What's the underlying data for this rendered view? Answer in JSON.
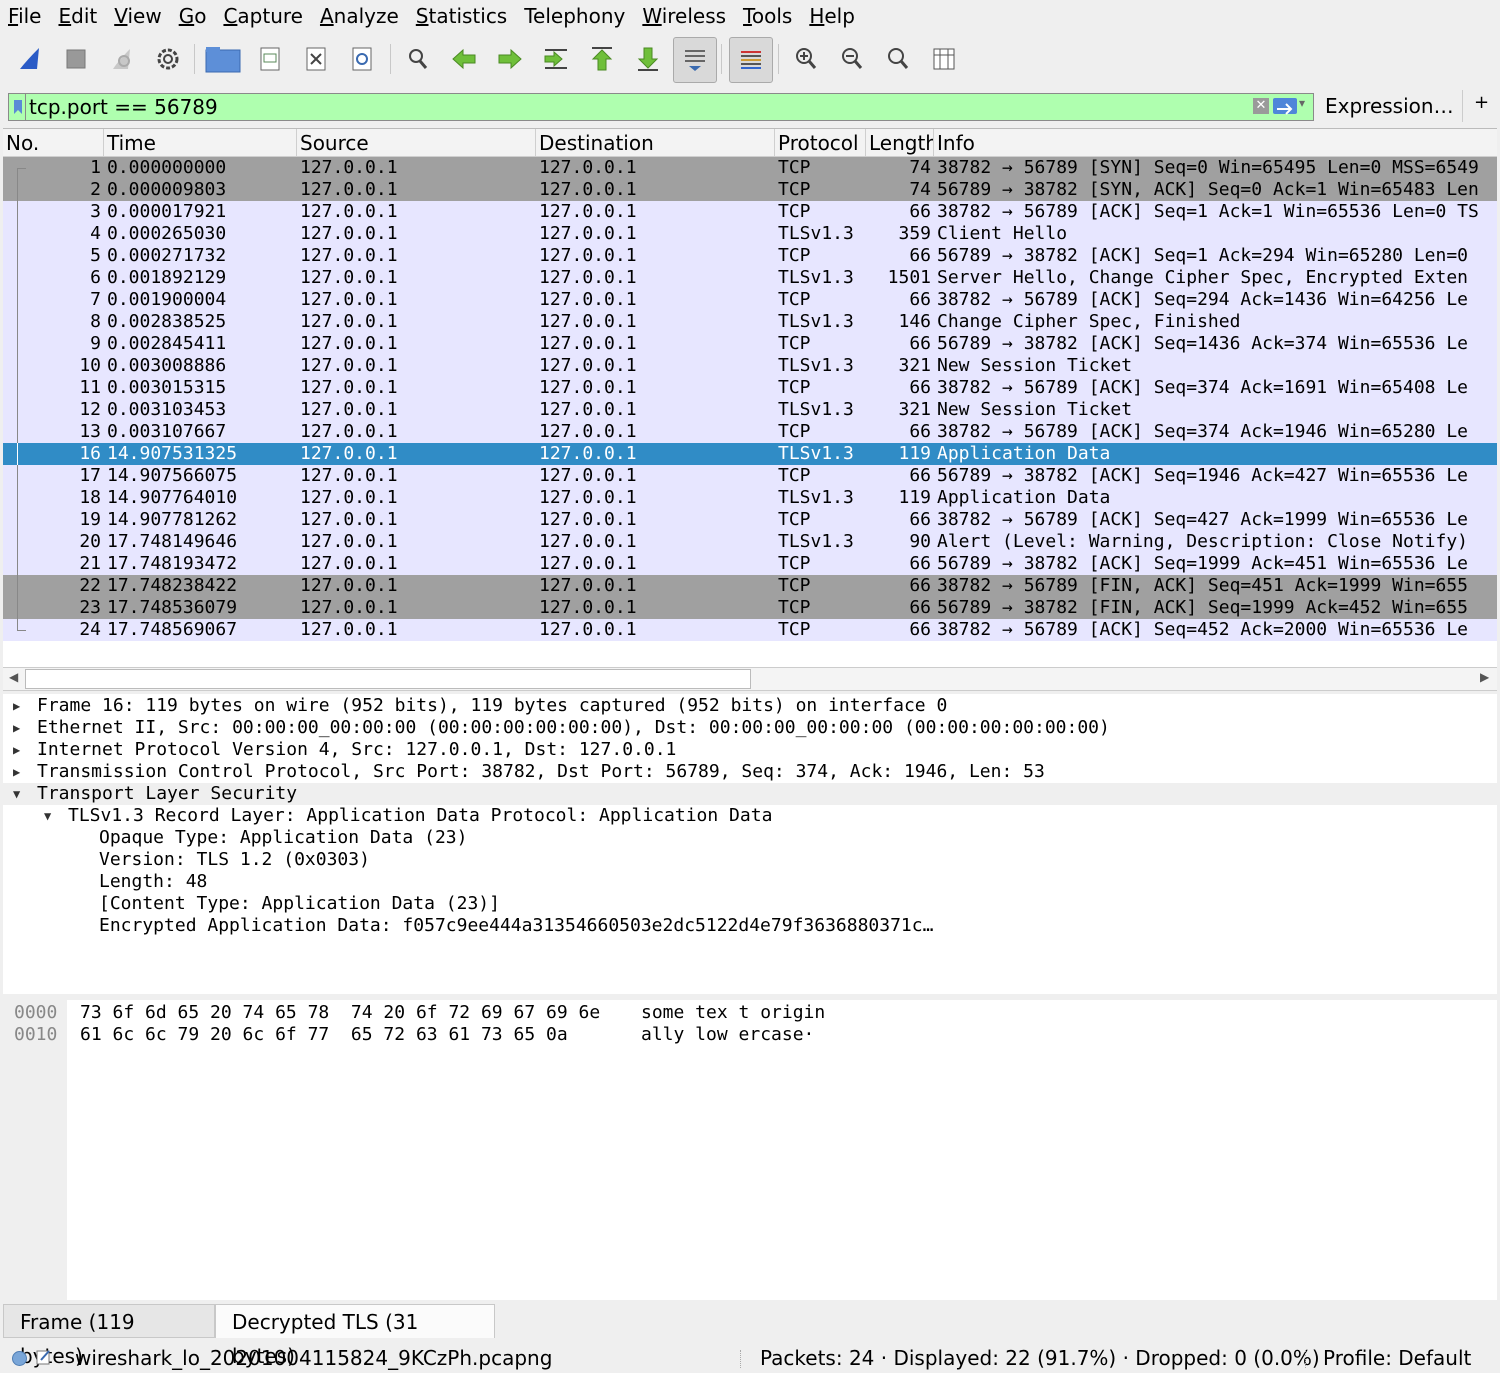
{
  "menu": [
    "File",
    "Edit",
    "View",
    "Go",
    "Capture",
    "Analyze",
    "Statistics",
    "Telephony",
    "Wireless",
    "Tools",
    "Help"
  ],
  "menu_mnemonic": [
    "F",
    "E",
    "V",
    "G",
    "C",
    "A",
    "S",
    "",
    "W",
    "T",
    "H"
  ],
  "toolbar_icons": [
    "shark-fin-start-icon",
    "stop-icon",
    "restart-icon",
    "options-gear-icon",
    "open-folder-icon",
    "save-icon",
    "close-file-icon",
    "reload-icon",
    "find-icon",
    "go-back-icon",
    "go-forward-icon",
    "go-to-packet-icon",
    "first-packet-icon",
    "last-packet-icon",
    "autoscroll-icon",
    "colorize-icon",
    "zoom-in-icon",
    "zoom-out-icon",
    "normal-size-icon",
    "resize-columns-icon"
  ],
  "filter": {
    "value": "tcp.port == 56789",
    "expression_label": "Expression…",
    "plus_label": "+"
  },
  "columns": [
    "No.",
    "Time",
    "Source",
    "Destination",
    "Protocol",
    "Length",
    "Info"
  ],
  "packets": [
    {
      "no": "1",
      "time": "0.000000000",
      "src": "127.0.0.1",
      "dst": "127.0.0.1",
      "proto": "TCP",
      "len": "74",
      "info": "38782 → 56789 [SYN] Seq=0 Win=65495 Len=0 MSS=6549",
      "style": "gray"
    },
    {
      "no": "2",
      "time": "0.000009803",
      "src": "127.0.0.1",
      "dst": "127.0.0.1",
      "proto": "TCP",
      "len": "74",
      "info": "56789 → 38782 [SYN, ACK] Seq=0 Ack=1 Win=65483 Len",
      "style": "gray"
    },
    {
      "no": "3",
      "time": "0.000017921",
      "src": "127.0.0.1",
      "dst": "127.0.0.1",
      "proto": "TCP",
      "len": "66",
      "info": "38782 → 56789 [ACK] Seq=1 Ack=1 Win=65536 Len=0 TS",
      "style": "lav"
    },
    {
      "no": "4",
      "time": "0.000265030",
      "src": "127.0.0.1",
      "dst": "127.0.0.1",
      "proto": "TLSv1.3",
      "len": "359",
      "info": "Client Hello",
      "style": "lav"
    },
    {
      "no": "5",
      "time": "0.000271732",
      "src": "127.0.0.1",
      "dst": "127.0.0.1",
      "proto": "TCP",
      "len": "66",
      "info": "56789 → 38782 [ACK] Seq=1 Ack=294 Win=65280 Len=0",
      "style": "lav"
    },
    {
      "no": "6",
      "time": "0.001892129",
      "src": "127.0.0.1",
      "dst": "127.0.0.1",
      "proto": "TLSv1.3",
      "len": "1501",
      "info": "Server Hello, Change Cipher Spec, Encrypted Exten",
      "style": "lav"
    },
    {
      "no": "7",
      "time": "0.001900004",
      "src": "127.0.0.1",
      "dst": "127.0.0.1",
      "proto": "TCP",
      "len": "66",
      "info": "38782 → 56789 [ACK] Seq=294 Ack=1436 Win=64256 Le",
      "style": "lav"
    },
    {
      "no": "8",
      "time": "0.002838525",
      "src": "127.0.0.1",
      "dst": "127.0.0.1",
      "proto": "TLSv1.3",
      "len": "146",
      "info": "Change Cipher Spec, Finished",
      "style": "lav"
    },
    {
      "no": "9",
      "time": "0.002845411",
      "src": "127.0.0.1",
      "dst": "127.0.0.1",
      "proto": "TCP",
      "len": "66",
      "info": "56789 → 38782 [ACK] Seq=1436 Ack=374 Win=65536 Le",
      "style": "lav"
    },
    {
      "no": "10",
      "time": "0.003008886",
      "src": "127.0.0.1",
      "dst": "127.0.0.1",
      "proto": "TLSv1.3",
      "len": "321",
      "info": "New Session Ticket",
      "style": "lav"
    },
    {
      "no": "11",
      "time": "0.003015315",
      "src": "127.0.0.1",
      "dst": "127.0.0.1",
      "proto": "TCP",
      "len": "66",
      "info": "38782 → 56789 [ACK] Seq=374 Ack=1691 Win=65408 Le",
      "style": "lav"
    },
    {
      "no": "12",
      "time": "0.003103453",
      "src": "127.0.0.1",
      "dst": "127.0.0.1",
      "proto": "TLSv1.3",
      "len": "321",
      "info": "New Session Ticket",
      "style": "lav"
    },
    {
      "no": "13",
      "time": "0.003107667",
      "src": "127.0.0.1",
      "dst": "127.0.0.1",
      "proto": "TCP",
      "len": "66",
      "info": "38782 → 56789 [ACK] Seq=374 Ack=1946 Win=65280 Le",
      "style": "lav"
    },
    {
      "no": "16",
      "time": "14.907531325",
      "src": "127.0.0.1",
      "dst": "127.0.0.1",
      "proto": "TLSv1.3",
      "len": "119",
      "info": "Application Data",
      "style": "sel"
    },
    {
      "no": "17",
      "time": "14.907566075",
      "src": "127.0.0.1",
      "dst": "127.0.0.1",
      "proto": "TCP",
      "len": "66",
      "info": "56789 → 38782 [ACK] Seq=1946 Ack=427 Win=65536 Le",
      "style": "lav"
    },
    {
      "no": "18",
      "time": "14.907764010",
      "src": "127.0.0.1",
      "dst": "127.0.0.1",
      "proto": "TLSv1.3",
      "len": "119",
      "info": "Application Data",
      "style": "lav"
    },
    {
      "no": "19",
      "time": "14.907781262",
      "src": "127.0.0.1",
      "dst": "127.0.0.1",
      "proto": "TCP",
      "len": "66",
      "info": "38782 → 56789 [ACK] Seq=427 Ack=1999 Win=65536 Le",
      "style": "lav"
    },
    {
      "no": "20",
      "time": "17.748149646",
      "src": "127.0.0.1",
      "dst": "127.0.0.1",
      "proto": "TLSv1.3",
      "len": "90",
      "info": "Alert (Level: Warning, Description: Close Notify)",
      "style": "lav"
    },
    {
      "no": "21",
      "time": "17.748193472",
      "src": "127.0.0.1",
      "dst": "127.0.0.1",
      "proto": "TCP",
      "len": "66",
      "info": "56789 → 38782 [ACK] Seq=1999 Ack=451 Win=65536 Le",
      "style": "lav"
    },
    {
      "no": "22",
      "time": "17.748238422",
      "src": "127.0.0.1",
      "dst": "127.0.0.1",
      "proto": "TCP",
      "len": "66",
      "info": "38782 → 56789 [FIN, ACK] Seq=451 Ack=1999 Win=655",
      "style": "gray"
    },
    {
      "no": "23",
      "time": "17.748536079",
      "src": "127.0.0.1",
      "dst": "127.0.0.1",
      "proto": "TCP",
      "len": "66",
      "info": "56789 → 38782 [FIN, ACK] Seq=1999 Ack=452 Win=655",
      "style": "gray"
    },
    {
      "no": "24",
      "time": "17.748569067",
      "src": "127.0.0.1",
      "dst": "127.0.0.1",
      "proto": "TCP",
      "len": "66",
      "info": "38782 → 56789 [ACK] Seq=452 Ack=2000 Win=65536 Le",
      "style": "lav"
    }
  ],
  "row_colors": {
    "gray": "#a0a0a0",
    "lav": "#e7e6ff",
    "sel": "#308cc6",
    "sel_text": "#ffffff"
  },
  "details": [
    {
      "text": "Frame 16: 119 bytes on wire (952 bits), 119 bytes captured (952 bits) on interface 0",
      "level": 0,
      "state": "collapsed"
    },
    {
      "text": "Ethernet II, Src: 00:00:00_00:00:00 (00:00:00:00:00:00), Dst: 00:00:00_00:00:00 (00:00:00:00:00:00)",
      "level": 0,
      "state": "collapsed"
    },
    {
      "text": "Internet Protocol Version 4, Src: 127.0.0.1, Dst: 127.0.0.1",
      "level": 0,
      "state": "collapsed"
    },
    {
      "text": "Transmission Control Protocol, Src Port: 38782, Dst Port: 56789, Seq: 374, Ack: 1946, Len: 53",
      "level": 0,
      "state": "collapsed"
    },
    {
      "text": "Transport Layer Security",
      "level": 0,
      "state": "expanded"
    },
    {
      "text": "TLSv1.3 Record Layer: Application Data Protocol: Application Data",
      "level": 1,
      "state": "expanded"
    },
    {
      "text": "Opaque Type: Application Data (23)",
      "level": 2,
      "state": "leaf"
    },
    {
      "text": "Version: TLS 1.2 (0x0303)",
      "level": 2,
      "state": "leaf"
    },
    {
      "text": "Length: 48",
      "level": 2,
      "state": "leaf"
    },
    {
      "text": "[Content Type: Application Data (23)]",
      "level": 2,
      "state": "leaf"
    },
    {
      "text": "Encrypted Application Data: f057c9ee444a31354660503e2dc5122d4e79f3636880371c…",
      "level": 2,
      "state": "leaf"
    }
  ],
  "bytes": [
    {
      "offset": "0000",
      "hex": "73 6f 6d 65 20 74 65 78  74 20 6f 72 69 67 69 6e",
      "ascii": "some tex t origin"
    },
    {
      "offset": "0010",
      "hex": "61 6c 6c 79 20 6c 6f 77  65 72 63 61 73 65 0a",
      "ascii": "ally low ercase·"
    }
  ],
  "tabs": [
    "Frame (119 bytes)",
    "Decrypted TLS (31 bytes)"
  ],
  "status": {
    "file": "wireshark_lo_20201004115824_9KCzPh.pcapng",
    "counts": "Packets: 24 · Displayed: 22 (91.7%) · Dropped: 0 (0.0%)",
    "profile": "Profile: Default"
  }
}
